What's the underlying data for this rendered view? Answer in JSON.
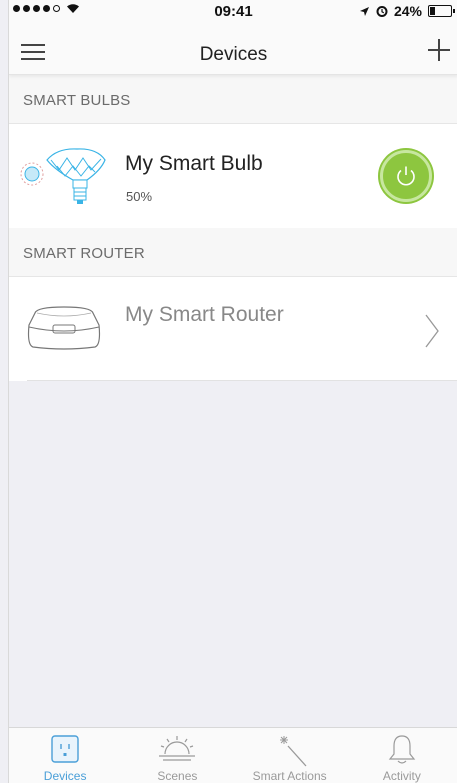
{
  "status_bar": {
    "time": "09:41",
    "battery": "24%",
    "battery_level": 0.24,
    "icons": [
      "signal-dots-icon",
      "wifi-icon",
      "location-arrow-icon",
      "alarm-icon",
      "battery-icon"
    ]
  },
  "nav": {
    "title": "Devices",
    "left_icon": "hamburger-menu-icon",
    "right_icon": "plus-icon"
  },
  "sections": [
    {
      "header": "SMART BULBS",
      "item": {
        "name": "My Smart Bulb",
        "detail": "50%",
        "icon": "smart-bulb-icon",
        "power_on": true,
        "power_color": "#8dc63f"
      }
    },
    {
      "header": "SMART ROUTER",
      "item": {
        "name": "My Smart Router",
        "icon": "router-icon",
        "action_icon": "chevron-right-icon"
      }
    }
  ],
  "tabs": [
    {
      "label": "Devices",
      "icon": "outlet-icon",
      "active": true
    },
    {
      "label": "Scenes",
      "icon": "sunrise-icon",
      "active": false
    },
    {
      "label": "Smart Actions",
      "icon": "magic-wand-icon",
      "active": false
    },
    {
      "label": "Activity",
      "icon": "bell-icon",
      "active": false
    }
  ],
  "colors": {
    "accent": "#4a9fd8",
    "power_on": "#8dc63f",
    "bulb_outline": "#3ab4e6"
  }
}
